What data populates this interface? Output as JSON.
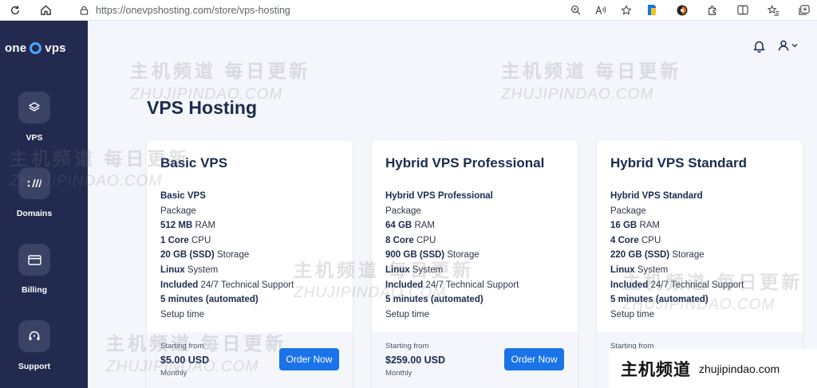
{
  "browser": {
    "url": "https://onevpshosting.com/store/vps-hosting"
  },
  "sidebar": {
    "logo_left": "one",
    "logo_right": "vps",
    "items": [
      {
        "label": "VPS",
        "icon": "layers-icon"
      },
      {
        "label": "Domains",
        "icon": "domains-icon"
      },
      {
        "label": "Billing",
        "icon": "credit-card-icon"
      },
      {
        "label": "Support",
        "icon": "headset-icon"
      }
    ]
  },
  "main": {
    "title": "VPS Hosting"
  },
  "cards": [
    {
      "title": "Basic VPS",
      "name": "Basic VPS",
      "package": "Package",
      "ram_val": "512 MB",
      "ram_unit": "RAM",
      "cpu_val": "1 Core",
      "cpu_unit": "CPU",
      "storage_val": "20 GB (SSD)",
      "storage_unit": "Storage",
      "os_val": "Linux",
      "os_unit": "System",
      "support_val": "Included",
      "support_unit": "24/7 Technical Support",
      "setup_val": "5 minutes (automated)",
      "setup_unit": "Setup time",
      "from": "Starting from",
      "price": "$5.00 USD",
      "period": "Monthly",
      "button": "Order Now"
    },
    {
      "title": "Hybrid VPS Professional",
      "name": "Hybrid VPS Professional",
      "package": "Package",
      "ram_val": "64 GB",
      "ram_unit": "RAM",
      "cpu_val": "8 Core",
      "cpu_unit": "CPU",
      "storage_val": "900 GB (SSD)",
      "storage_unit": "Storage",
      "os_val": "Linux",
      "os_unit": "System",
      "support_val": "Included",
      "support_unit": "24/7 Technical Support",
      "setup_val": "5 minutes (automated)",
      "setup_unit": "Setup time",
      "from": "Starting from",
      "price": "$259.00 USD",
      "period": "Monthly",
      "button": "Order Now"
    },
    {
      "title": "Hybrid VPS Standard",
      "name": "Hybrid VPS Standard",
      "package": "Package",
      "ram_val": "16 GB",
      "ram_unit": "RAM",
      "cpu_val": "4 Core",
      "cpu_unit": "CPU",
      "storage_val": "220 GB (SSD)",
      "storage_unit": "Storage",
      "os_val": "Linux",
      "os_unit": "System",
      "support_val": "Included",
      "support_unit": "24/7 Technical Support",
      "setup_val": "5 minutes (automated)",
      "setup_unit": "Setup time",
      "from": "Starting from"
    }
  ],
  "watermark": {
    "cn": "主机频道 每日更新",
    "en": "ZHUJIPINDAO.COM"
  },
  "badge": {
    "cn": "主机频道",
    "url": "zhujipindao.com"
  },
  "colors": {
    "sidebar": "#232a4f",
    "accent": "#1a73e8",
    "title": "#1b2b4e"
  }
}
